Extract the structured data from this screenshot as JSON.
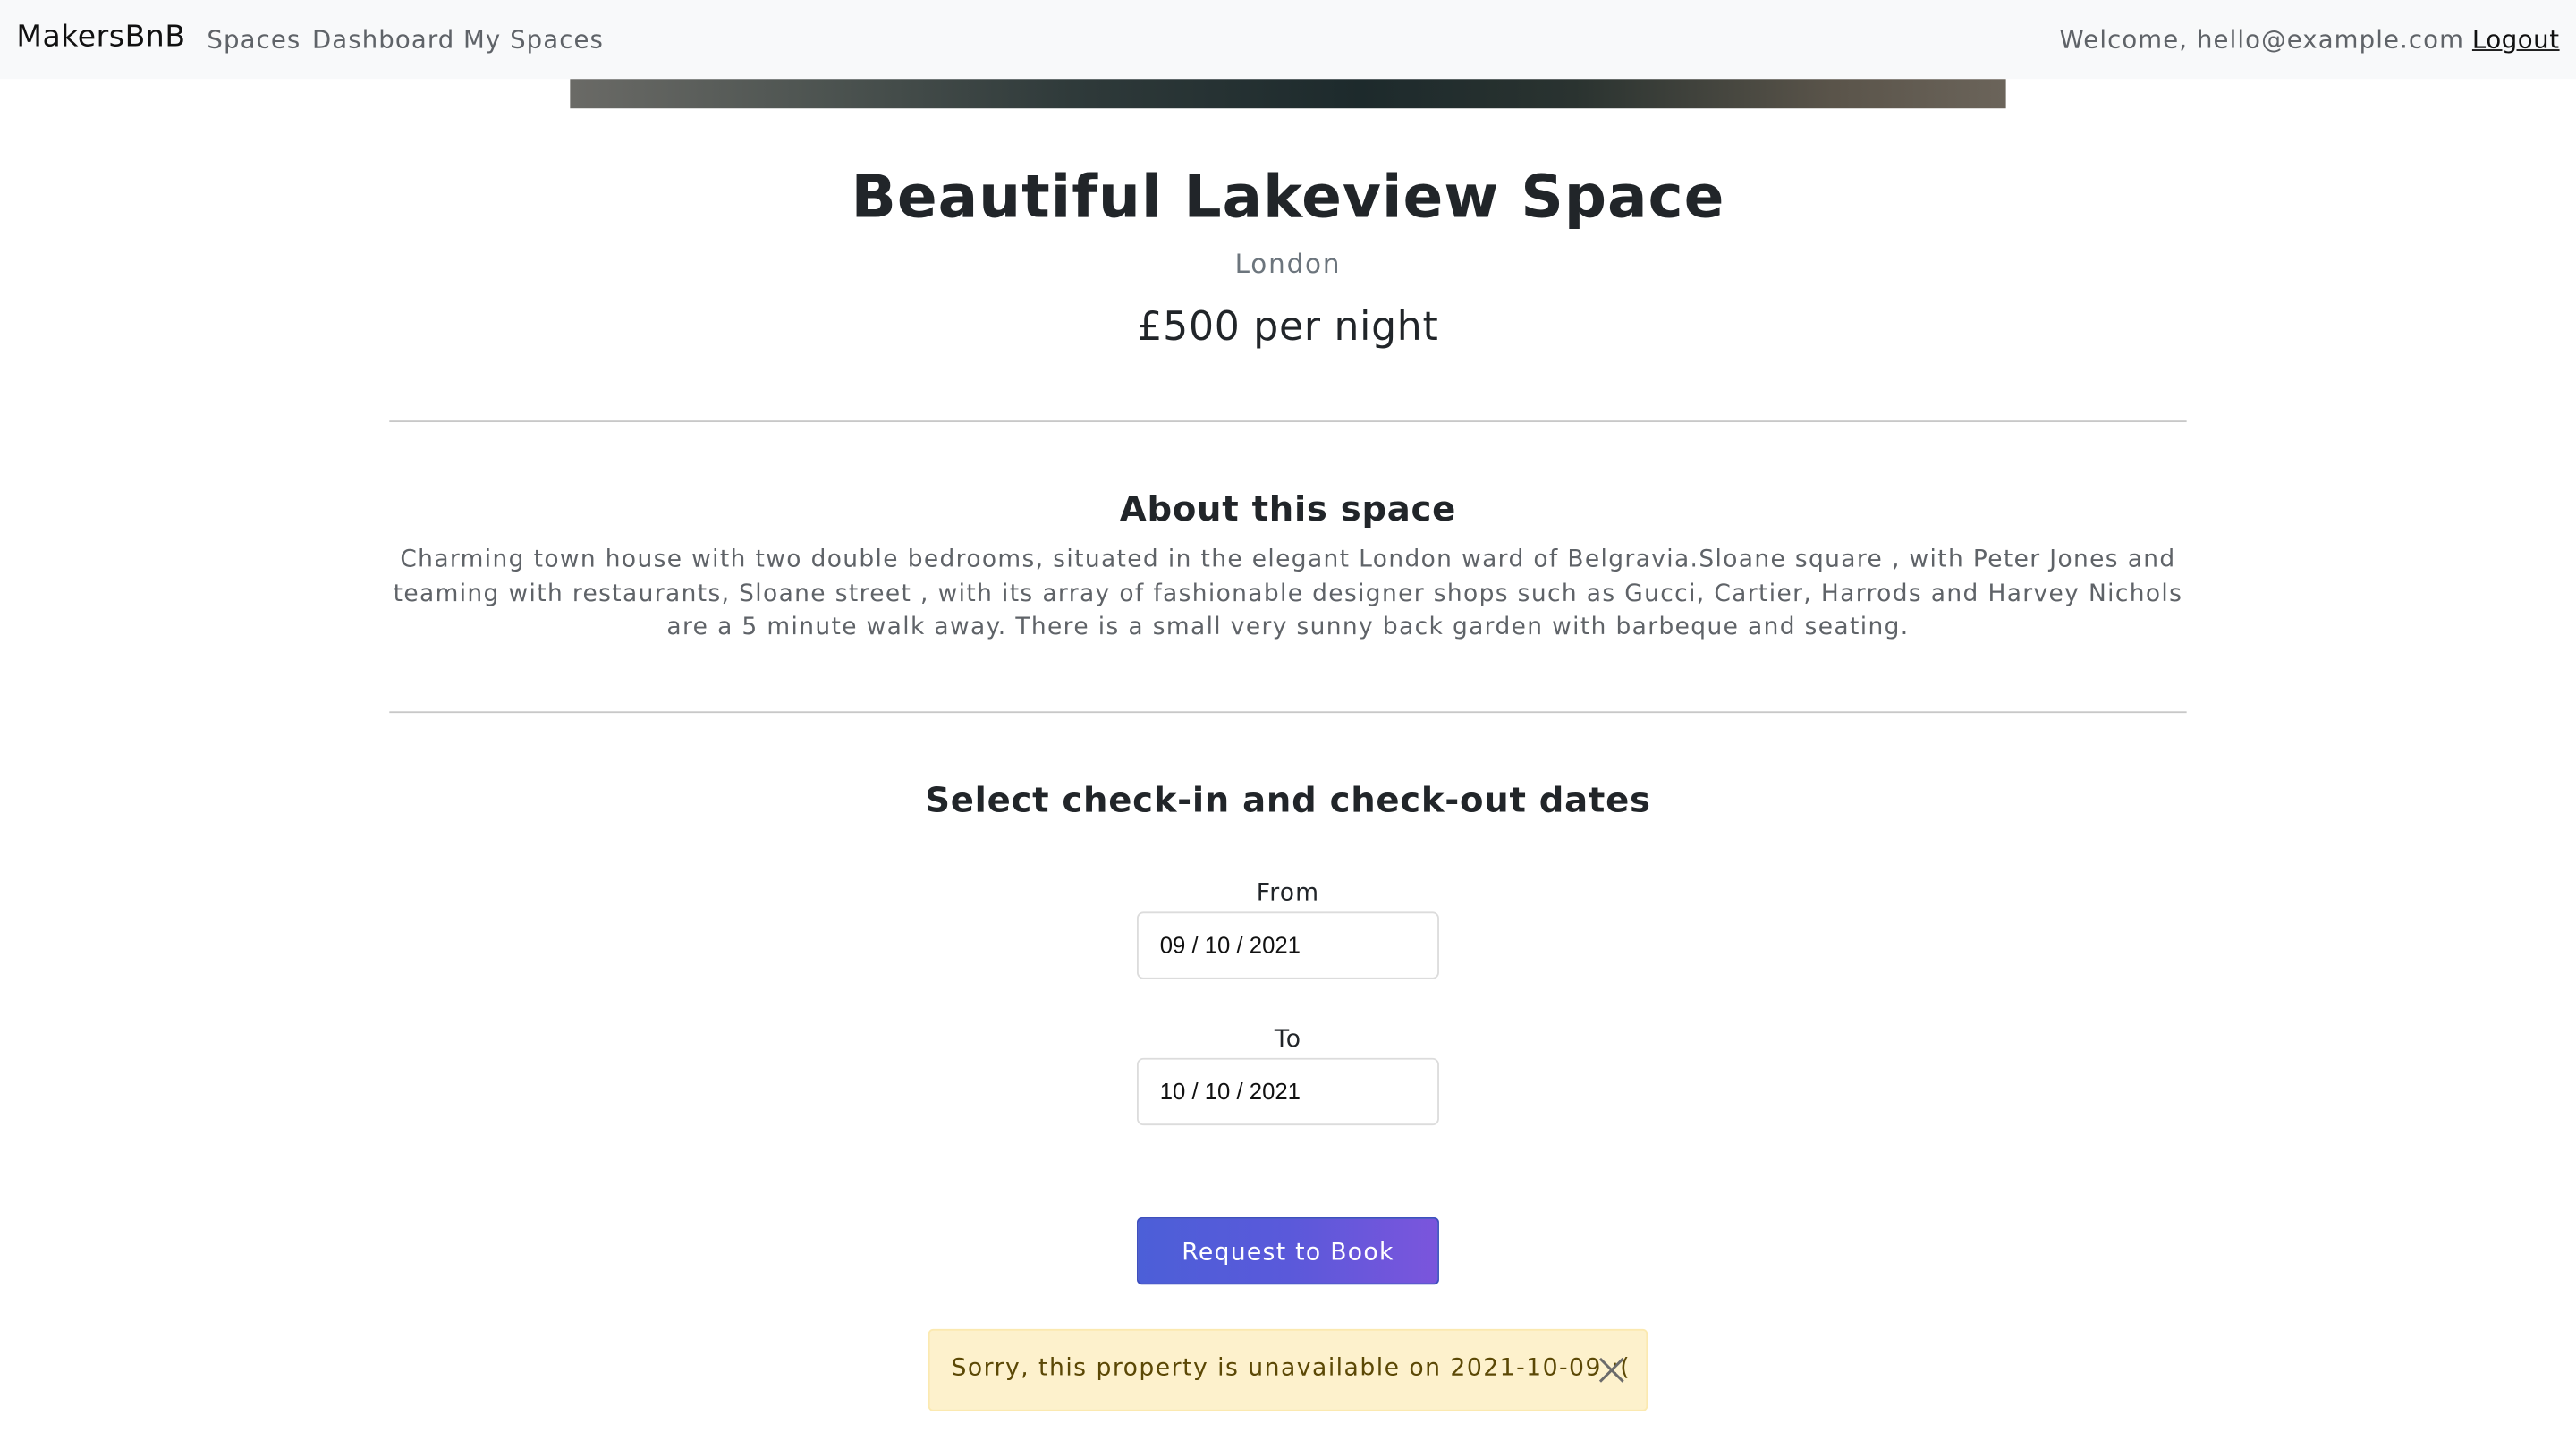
{
  "navbar": {
    "brand": "MakersBnB",
    "links": [
      "Spaces",
      "Dashboard",
      "My Spaces"
    ],
    "welcome": "Welcome, hello@example.com",
    "logout": "Logout"
  },
  "space": {
    "title": "Beautiful Lakeview Space",
    "location": "London",
    "price": "£500 per night"
  },
  "about": {
    "heading": "About this space",
    "description": "Charming town house with two double bedrooms, situated in the elegant London ward of Belgravia.Sloane square , with Peter Jones and teaming with restaurants, Sloane street , with its array of fashionable designer shops such as Gucci, Cartier, Harrods and Harvey Nichols are a 5 minute walk away. There is a small very sunny back garden with barbeque and seating."
  },
  "booking": {
    "heading": "Select check-in and check-out dates",
    "from_label": "From",
    "from_value": "09 / 10 / 2021",
    "to_label": "To",
    "to_value": "10 / 10 / 2021",
    "button": "Request to Book"
  },
  "alert": {
    "message": "Sorry, this property is unavailable on 2021-10-09 :(",
    "close_icon": "close-icon"
  },
  "colors": {
    "navbar_bg": "#f8f9fa",
    "button_start": "#4c5fd8",
    "button_end": "#7b55dc",
    "alert_bg": "#fdf1cc",
    "alert_text": "#5b4805"
  }
}
